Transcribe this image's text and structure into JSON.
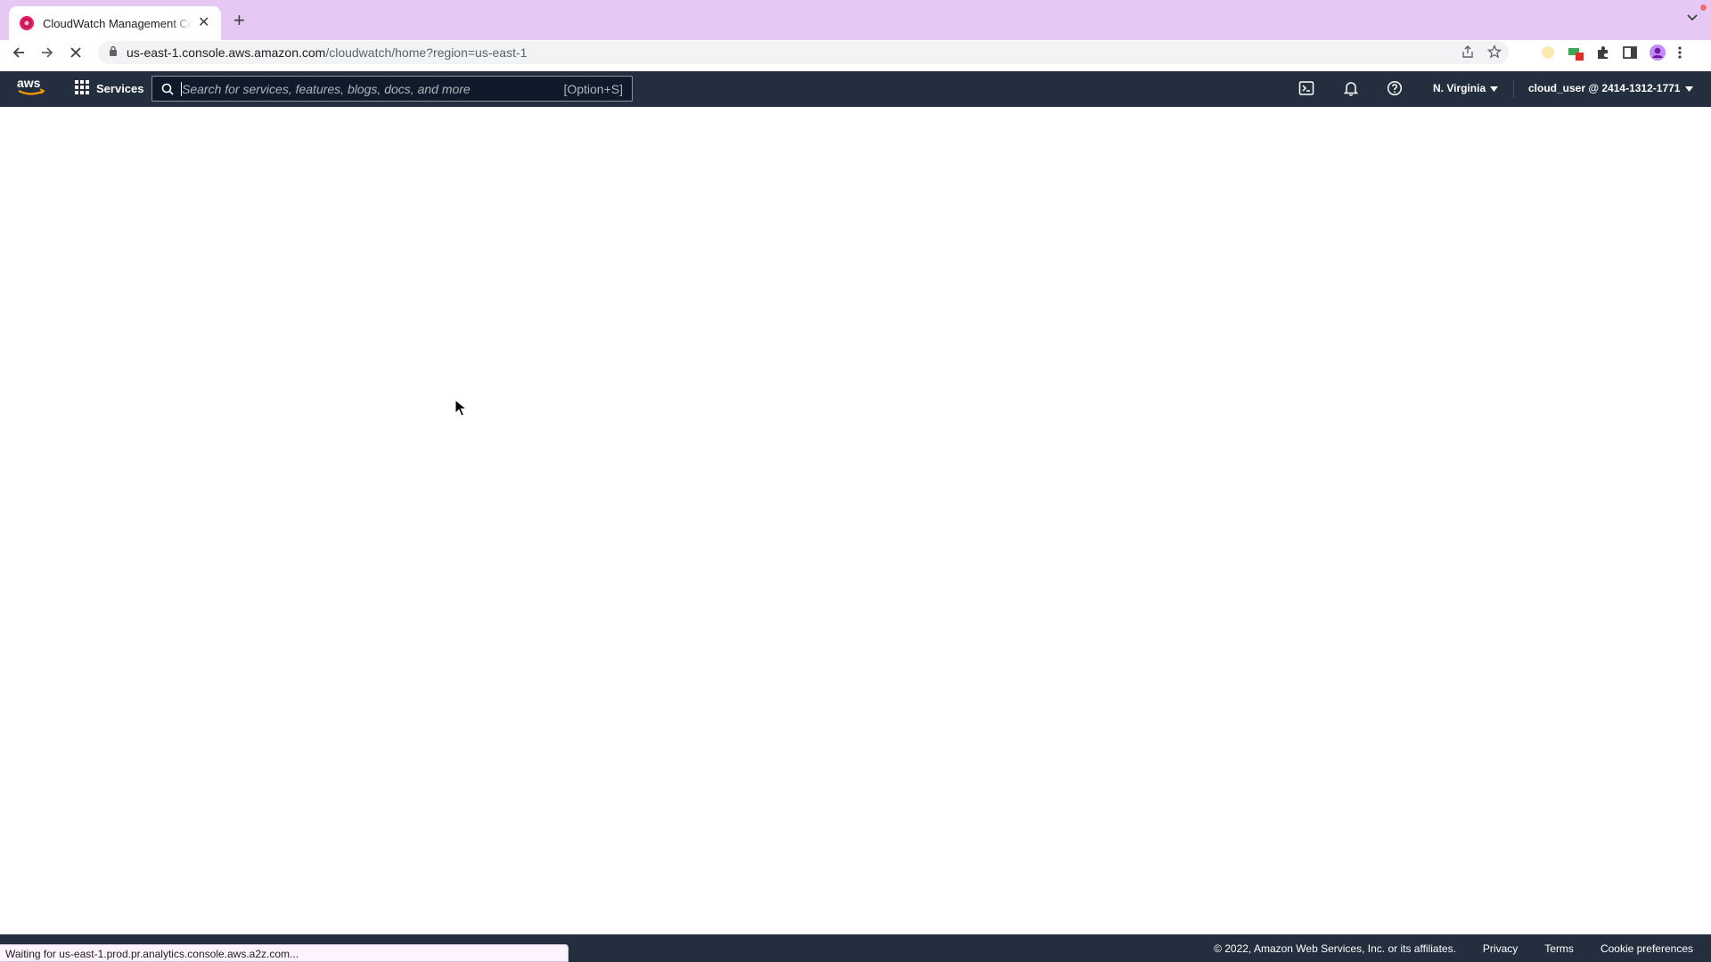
{
  "browser": {
    "tab": {
      "title": "CloudWatch Management Con"
    },
    "url": {
      "host": "us-east-1.console.aws.amazon.com",
      "path": "/cloudwatch/home?region=us-east-1"
    }
  },
  "aws_nav": {
    "services_label": "Services",
    "search": {
      "placeholder": "Search for services, features, blogs, docs, and more",
      "value": "",
      "shortcut": "[Option+S]"
    },
    "region": "N. Virginia",
    "account": "cloud_user @ 2414-1312-1771"
  },
  "footer": {
    "copyright": "© 2022, Amazon Web Services, Inc. or its affiliates.",
    "links": {
      "privacy": "Privacy",
      "terms": "Terms",
      "cookie_preferences": "Cookie preferences"
    }
  },
  "status_bar": {
    "text": "Waiting for us-east-1.prod.pr.analytics.console.aws.a2z.com..."
  },
  "colors": {
    "tab_strip": "#e6c8f4",
    "aws_nav": "#232f3e",
    "aws_orange": "#ff9900"
  },
  "icons": [
    "favicon-icon",
    "close-icon",
    "plus-icon",
    "chevron-down-icon",
    "back-icon",
    "forward-icon",
    "stop-loading-icon",
    "lock-icon",
    "share-icon",
    "star-icon",
    "extension-icon",
    "puzzle-icon",
    "sidepanel-icon",
    "profile-icon",
    "kebab-menu-icon",
    "aws-logo",
    "grid-icon",
    "search-icon",
    "cloudshell-icon",
    "bell-icon",
    "help-icon",
    "caret-down-icon",
    "cursor-icon"
  ]
}
